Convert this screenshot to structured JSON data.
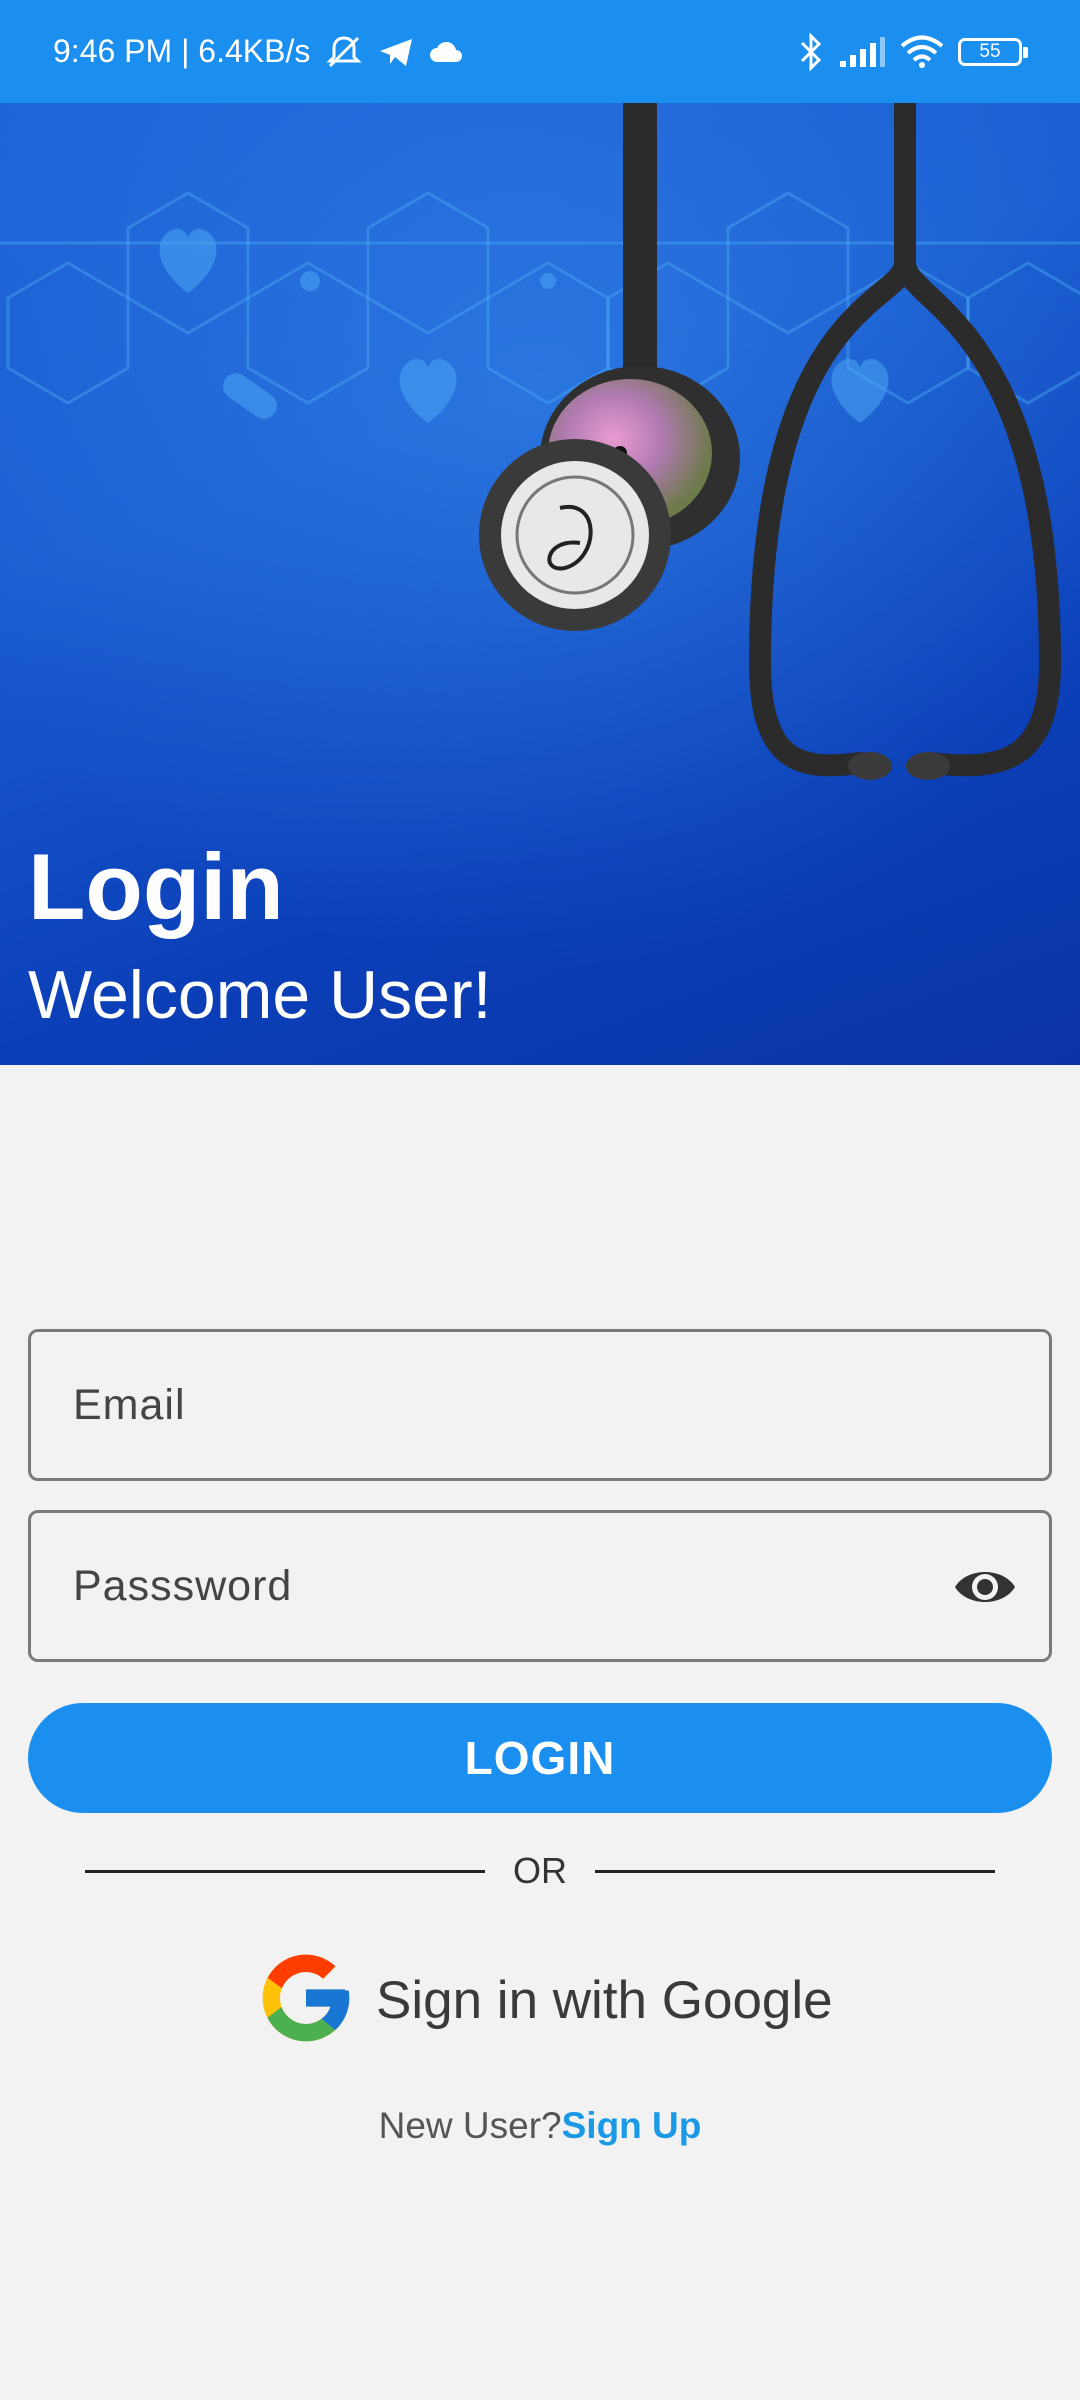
{
  "status_bar": {
    "time_speed": "9:46 PM | 6.4KB/s",
    "battery": "55",
    "icons": [
      "mute-icon",
      "telegram-icon",
      "cloud-icon",
      "bluetooth-icon",
      "signal-icon",
      "wifi-icon",
      "battery-icon"
    ]
  },
  "hero": {
    "title": "Login",
    "subtitle": "Welcome User!"
  },
  "form": {
    "email_placeholder": "Email",
    "password_placeholder": "Passsword",
    "login_label": "LOGIN",
    "or_label": "OR",
    "google_label": "Sign in with Google"
  },
  "signup": {
    "prompt": "New User?",
    "link": "Sign Up"
  },
  "colors": {
    "accent": "#1b8ff0",
    "link": "#1a9ae6",
    "hero_dark": "#0a33a6"
  }
}
